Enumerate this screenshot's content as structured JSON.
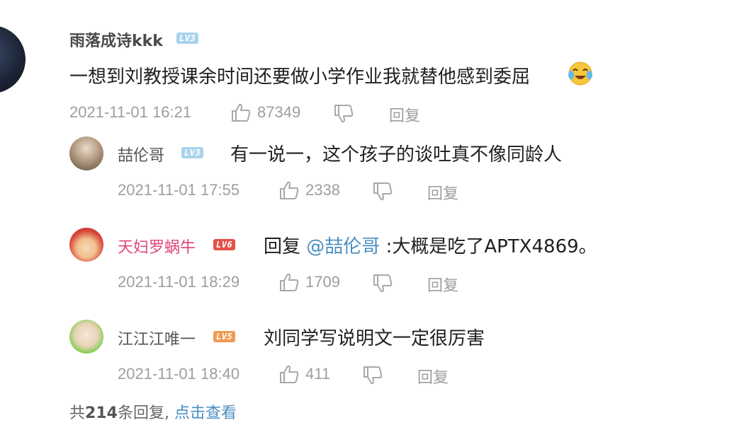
{
  "main_comment": {
    "username": "雨落成诗kkk",
    "level": "LV3",
    "text": "一想到刘教授课余时间还要做小学作业我就替他感到委屈",
    "emoji": "crying-laughing-emoji",
    "timestamp": "2021-11-01 16:21",
    "likes": "87349",
    "reply_label": "回复"
  },
  "replies": [
    {
      "username": "喆伦哥",
      "level": "LV3",
      "text": "有一说一，这个孩子的谈吐真不像同龄人",
      "timestamp": "2021-11-01 17:55",
      "likes": "2338",
      "reply_label": "回复"
    },
    {
      "username": "天妇罗蜗牛",
      "level": "LV6",
      "reply_prefix": "回复",
      "mention": "@喆伦哥",
      "text": ":大概是吃了APTX4869。",
      "timestamp": "2021-11-01 18:29",
      "likes": "1709",
      "reply_label": "回复"
    },
    {
      "username": "江江江唯一",
      "level": "LV5",
      "text": "刘同学写说明文一定很厉害",
      "timestamp": "2021-11-01 18:40",
      "likes": "411",
      "reply_label": "回复"
    }
  ],
  "footer": {
    "prefix": "共",
    "count": "214",
    "suffix": "条回复,",
    "view_link": "点击查看"
  },
  "colors": {
    "accent_link": "#4a8ec2",
    "meta_gray": "#9e9e9e",
    "lv3": "#a9d3ea",
    "lv5": "#f09a52",
    "lv6": "#e45049",
    "vip_name": "#e0457a"
  }
}
